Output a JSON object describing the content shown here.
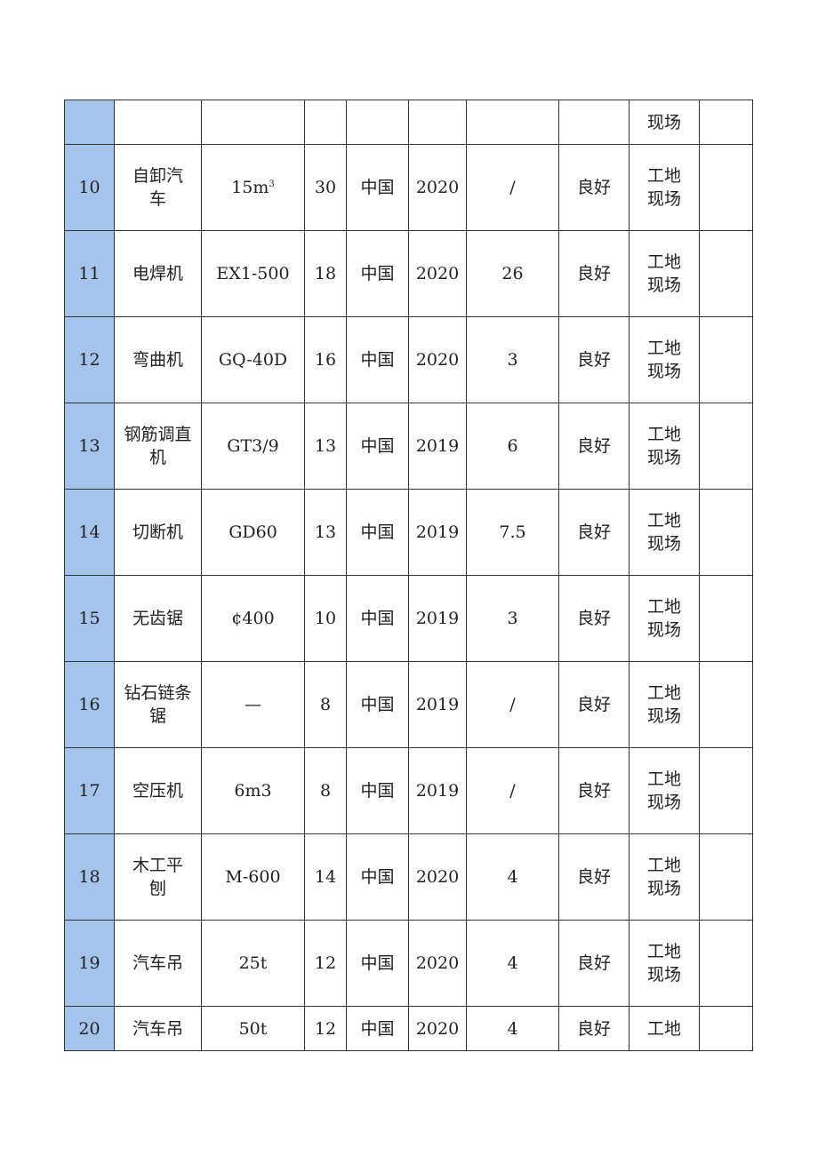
{
  "table": {
    "partial_top_row": {
      "no": "",
      "name": "",
      "model": "",
      "qty": "",
      "origin": "",
      "year": "",
      "power": "",
      "condition": "",
      "location_lines": [
        "现场"
      ],
      "remark": ""
    },
    "rows": [
      {
        "no": "10",
        "name_lines": [
          "自卸汽",
          "车"
        ],
        "model": "15m",
        "model_sup": "3",
        "qty": "30",
        "origin": "中国",
        "year": "2020",
        "power": "/",
        "condition": "良好",
        "location_lines": [
          "工地",
          "现场"
        ],
        "remark": ""
      },
      {
        "no": "11",
        "name_lines": [
          "电焊机"
        ],
        "model": "EX1-500",
        "model_sup": "",
        "qty": "18",
        "origin": "中国",
        "year": "2020",
        "power": "26",
        "condition": "良好",
        "location_lines": [
          "工地",
          "现场"
        ],
        "remark": ""
      },
      {
        "no": "12",
        "name_lines": [
          "弯曲机"
        ],
        "model": "GQ-40D",
        "model_sup": "",
        "qty": "16",
        "origin": "中国",
        "year": "2020",
        "power": "3",
        "condition": "良好",
        "location_lines": [
          "工地",
          "现场"
        ],
        "remark": ""
      },
      {
        "no": "13",
        "name_lines": [
          "钢筋调直",
          "机"
        ],
        "model": "GT3/9",
        "model_sup": "",
        "qty": "13",
        "origin": "中国",
        "year": "2019",
        "power": "6",
        "condition": "良好",
        "location_lines": [
          "工地",
          "现场"
        ],
        "remark": ""
      },
      {
        "no": "14",
        "name_lines": [
          "切断机"
        ],
        "model": "GD60",
        "model_sup": "",
        "qty": "13",
        "origin": "中国",
        "year": "2019",
        "power": "7.5",
        "condition": "良好",
        "location_lines": [
          "工地",
          "现场"
        ],
        "remark": ""
      },
      {
        "no": "15",
        "name_lines": [
          "无齿锯"
        ],
        "model": "¢400",
        "model_sup": "",
        "qty": "10",
        "origin": "中国",
        "year": "2019",
        "power": "3",
        "condition": "良好",
        "location_lines": [
          "工地",
          "现场"
        ],
        "remark": ""
      },
      {
        "no": "16",
        "name_lines": [
          "钻石链条",
          "锯"
        ],
        "model": "—",
        "model_sup": "",
        "qty": "8",
        "origin": "中国",
        "year": "2019",
        "power": "/",
        "condition": "良好",
        "location_lines": [
          "工地",
          "现场"
        ],
        "remark": ""
      },
      {
        "no": "17",
        "name_lines": [
          "空压机"
        ],
        "model": "6m3",
        "model_sup": "",
        "qty": "8",
        "origin": "中国",
        "year": "2019",
        "power": "/",
        "condition": "良好",
        "location_lines": [
          "工地",
          "现场"
        ],
        "remark": ""
      },
      {
        "no": "18",
        "name_lines": [
          "木工平",
          "刨"
        ],
        "model": "M-600",
        "model_sup": "",
        "qty": "14",
        "origin": "中国",
        "year": "2020",
        "power": "4",
        "condition": "良好",
        "location_lines": [
          "工地",
          "现场"
        ],
        "remark": ""
      },
      {
        "no": "19",
        "name_lines": [
          "汽车吊"
        ],
        "model": "25t",
        "model_sup": "",
        "qty": "12",
        "origin": "中国",
        "year": "2020",
        "power": "4",
        "condition": "良好",
        "location_lines": [
          "工地",
          "现场"
        ],
        "remark": ""
      },
      {
        "no": "20",
        "name_lines": [
          "汽车吊"
        ],
        "model": "50t",
        "model_sup": "",
        "qty": "12",
        "origin": "中国",
        "year": "2020",
        "power": "4",
        "condition": "良好",
        "location_lines": [
          "工地"
        ],
        "remark": ""
      }
    ]
  },
  "colors": {
    "number_column_bg": "#a4c4ec",
    "border": "#333333"
  }
}
